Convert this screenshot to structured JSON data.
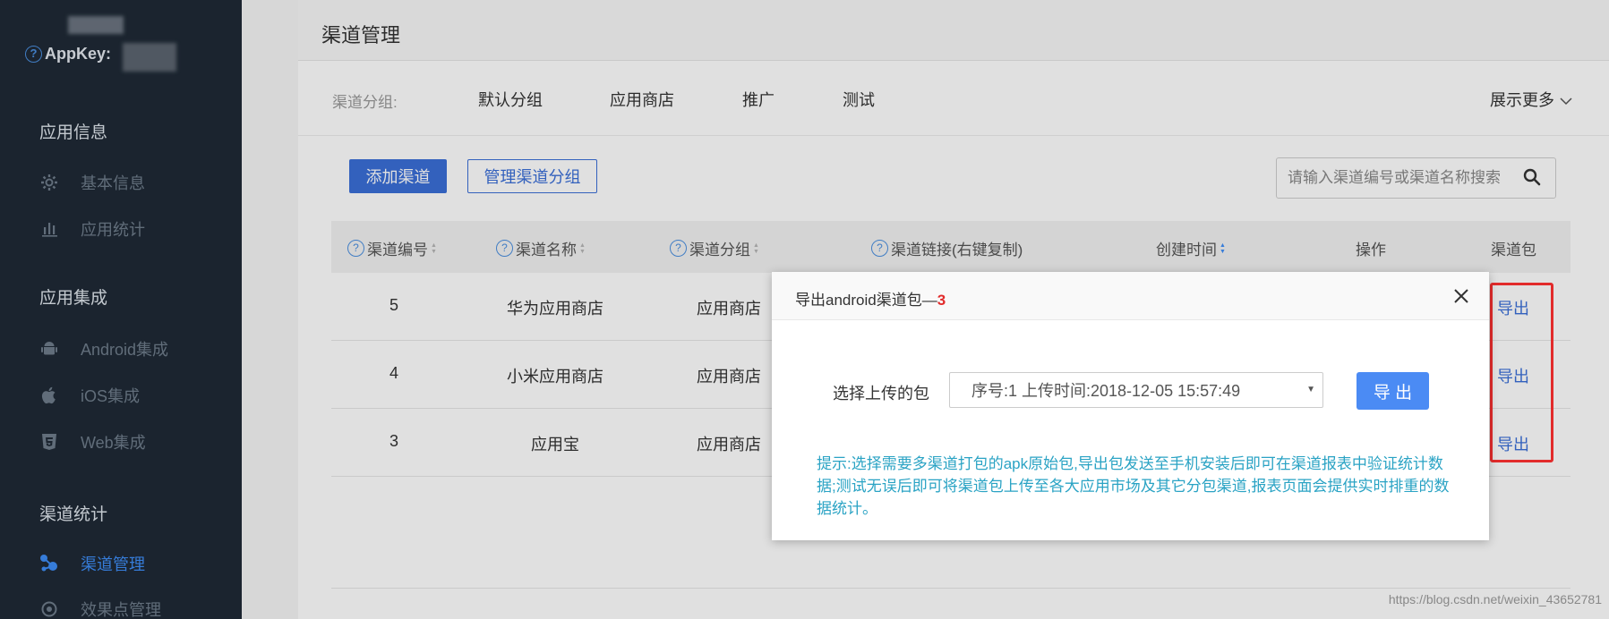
{
  "sidebar": {
    "appkey_label": "AppKey:",
    "sections": [
      {
        "title": "应用信息",
        "items": [
          {
            "label": "基本信息",
            "icon": "gear-icon"
          },
          {
            "label": "应用统计",
            "icon": "bar-chart-icon"
          }
        ]
      },
      {
        "title": "应用集成",
        "items": [
          {
            "label": "Android集成",
            "icon": "android-icon"
          },
          {
            "label": "iOS集成",
            "icon": "apple-icon"
          },
          {
            "label": "Web集成",
            "icon": "html5-icon"
          }
        ]
      },
      {
        "title": "渠道统计",
        "items": [
          {
            "label": "渠道管理",
            "icon": "channel-icon",
            "active": true
          },
          {
            "label": "效果点管理",
            "icon": "target-icon"
          }
        ]
      }
    ]
  },
  "main": {
    "title": "渠道管理",
    "group_label": "渠道分组:",
    "groups": [
      "默认分组",
      "应用商店",
      "推广",
      "测试"
    ],
    "show_more": "展示更多",
    "add_channel": "添加渠道",
    "manage_groups": "管理渠道分组",
    "search": {
      "placeholder": "请输入渠道编号或渠道名称搜索"
    },
    "table": {
      "headers": [
        "渠道编号",
        "渠道名称",
        "渠道分组",
        "渠道链接(右键复制)",
        "创建时间",
        "操作",
        "渠道包"
      ],
      "rows": [
        {
          "id": "5",
          "name": "华为应用商店",
          "group": "应用商店",
          "export": "导出"
        },
        {
          "id": "4",
          "name": "小米应用商店",
          "group": "应用商店",
          "export": "导出"
        },
        {
          "id": "3",
          "name": "应用宝",
          "group": "应用商店",
          "export": "导出"
        }
      ]
    }
  },
  "modal": {
    "title_prefix": "导出android渠道包—",
    "title_num": "3",
    "select_label": "选择上传的包",
    "select_value": "序号:1 上传时间:2018-12-05 15:57:49",
    "export_button": "导 出",
    "tip": "提示:选择需要多渠道打包的apk原始包,导出包发送至手机安装后即可在渠道报表中验证统计数据;测试无误后即可将渠道包上传至各大应用市场及其它分包渠道,报表页面会提供实时排重的数据统计。"
  },
  "watermark": "https://blog.csdn.net/weixin_43652781",
  "colors": {
    "sidebar_bg": "#1f2a36",
    "primary": "#3b6fd8",
    "accent_red": "#e22b2b",
    "tip": "#2aa3c4"
  }
}
